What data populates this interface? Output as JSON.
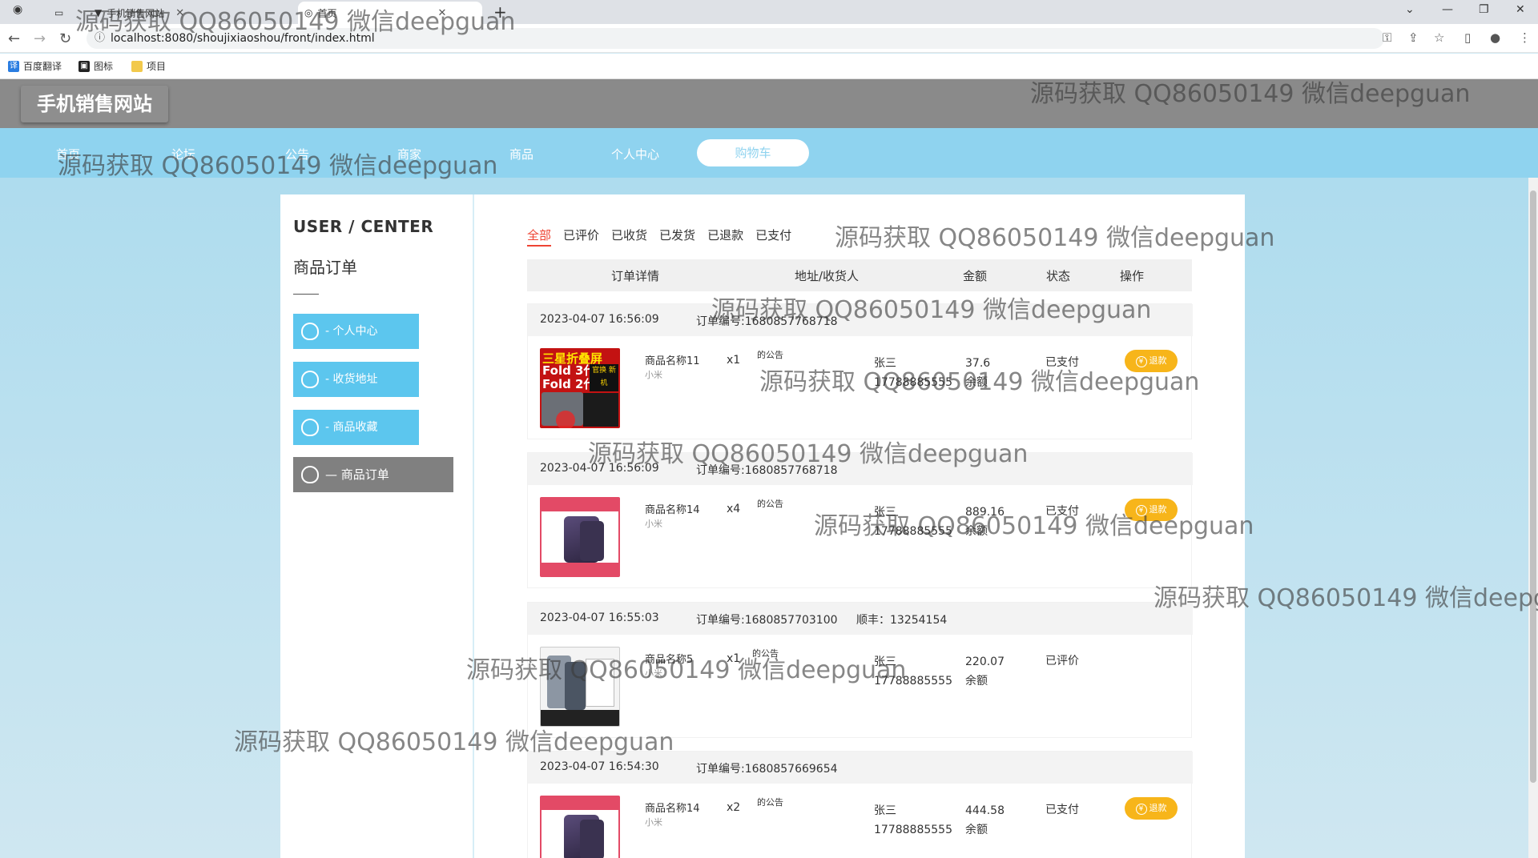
{
  "browser": {
    "tabs": [
      {
        "label": "手机销售网站",
        "active": false
      },
      {
        "label": "首页",
        "active": true
      }
    ],
    "url": "localhost:8080/shoujixiaoshou/front/index.html",
    "bookmarks": [
      {
        "label": "百度翻译",
        "icon": "translate-icon"
      },
      {
        "label": "图标",
        "icon": "image-icon"
      },
      {
        "label": "项目",
        "icon": "folder-icon"
      }
    ]
  },
  "site": {
    "logo": "手机销售网站",
    "nav": [
      "首页",
      "论坛",
      "公告",
      "商家",
      "商品",
      "个人中心"
    ],
    "cart_label": "购物车"
  },
  "sidebar": {
    "title": "USER / CENTER",
    "subtitle": "商品订单",
    "items": [
      {
        "label": "- 个人中心"
      },
      {
        "label": "- 收货地址"
      },
      {
        "label": "- 商品收藏"
      },
      {
        "label": "— 商品订单",
        "active": true
      }
    ]
  },
  "orders_view": {
    "tabs": [
      "全部",
      "已评价",
      "已收货",
      "已发货",
      "已退款",
      "已支付"
    ],
    "headers": [
      "订单详情",
      "地址/收货人",
      "金额",
      "状态",
      "操作"
    ],
    "refund_label": "退款",
    "orders": [
      {
        "time": "2023-04-07 16:56:09",
        "order_no": "订单编号:1680857768718",
        "express": "",
        "name": "商品名称11",
        "brand": "小米",
        "qty": "x1",
        "notice": "的公告",
        "receiver": "张三",
        "phone": "17788885555",
        "amount": "37.6",
        "pay": "余额",
        "status": "已支付",
        "refund": true,
        "thumb": "fold"
      },
      {
        "time": "2023-04-07 16:56:09",
        "order_no": "订单编号:1680857768718",
        "express": "",
        "name": "商品名称14",
        "brand": "小米",
        "qty": "x4",
        "notice": "的公告",
        "receiver": "张三",
        "phone": "17788885555",
        "amount": "889.16",
        "pay": "余额",
        "status": "已支付",
        "refund": true,
        "thumb": "iphone"
      },
      {
        "time": "2023-04-07 16:55:03",
        "order_no": "订单编号:1680857703100",
        "express": "顺丰：13254154",
        "name": "商品名称5",
        "brand": "小米",
        "qty": "x1",
        "notice": "的公告",
        "receiver": "张三",
        "phone": "17788885555",
        "amount": "220.07",
        "pay": "余额",
        "status": "已评价",
        "refund": false,
        "thumb": "xiaomi"
      },
      {
        "time": "2023-04-07 16:54:30",
        "order_no": "订单编号:1680857669654",
        "express": "",
        "name": "商品名称14",
        "brand": "小米",
        "qty": "x2",
        "notice": "的公告",
        "receiver": "张三",
        "phone": "17788885555",
        "amount": "444.58",
        "pay": "余额",
        "status": "已支付",
        "refund": true,
        "thumb": "iphone"
      }
    ]
  },
  "watermark": "源码获取 QQ86050149 微信deepguan",
  "thumb_text": {
    "fold_title": "三星折叠屏",
    "fold_line1": "Fold 3代",
    "fold_line2": "Fold 2代",
    "fold_tag": "官换 新机"
  }
}
